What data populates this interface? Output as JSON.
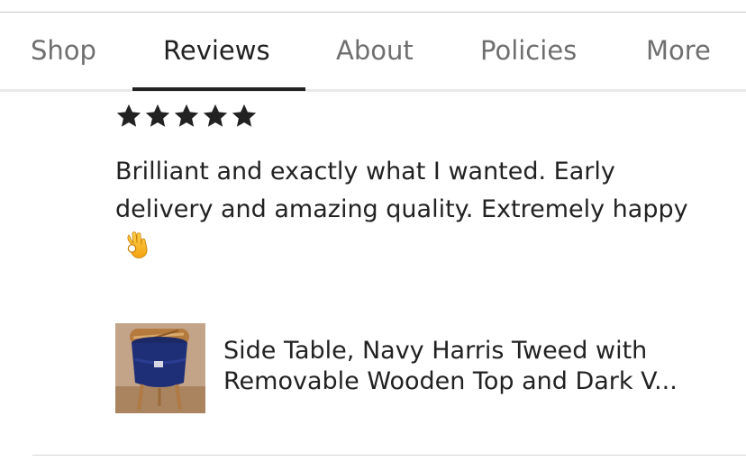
{
  "tabs": [
    {
      "label": "Shop",
      "active": false
    },
    {
      "label": "Reviews",
      "active": true
    },
    {
      "label": "About",
      "active": false
    },
    {
      "label": "Policies",
      "active": false
    },
    {
      "label": "More",
      "active": false
    }
  ],
  "review": {
    "rating": 5,
    "rating_max": 5,
    "star_icon": "star-icon",
    "star_color": "#222222",
    "text": "Brilliant and exactly what I wanted. Early delivery and amazing quality. Extremely happy",
    "emoji": "ok-hand-emoji"
  },
  "product": {
    "title": "Side Table, Navy Harris Tweed with Removable Wooden Top and Dark V..."
  },
  "colors": {
    "text_primary": "#222222",
    "text_muted": "#6f6f6f",
    "tab_underline": "#222222",
    "divider": "#e9e9e9"
  }
}
